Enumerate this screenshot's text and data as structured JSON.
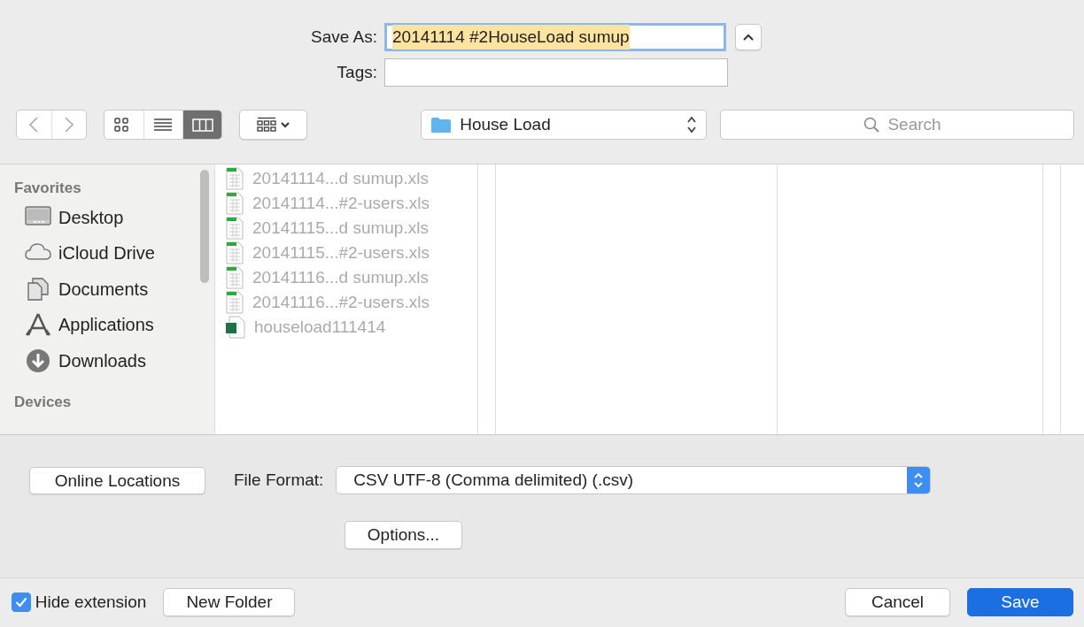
{
  "save_as": {
    "label": "Save As:",
    "value": "20141114 #2HouseLoad sumup"
  },
  "tags": {
    "label": "Tags:"
  },
  "view_modes": [
    {
      "kind": "icons",
      "selected": false
    },
    {
      "kind": "list",
      "selected": false
    },
    {
      "kind": "columns",
      "selected": true
    }
  ],
  "location": {
    "value": "House Load"
  },
  "search": {
    "placeholder": "Search"
  },
  "sidebar": {
    "sections": [
      {
        "title": "Favorites",
        "items": [
          {
            "kind": "desktop",
            "label": "Desktop"
          },
          {
            "kind": "cloud",
            "label": "iCloud Drive"
          },
          {
            "kind": "documents",
            "label": "Documents"
          },
          {
            "kind": "applications",
            "label": "Applications"
          },
          {
            "kind": "downloads",
            "label": "Downloads"
          }
        ]
      },
      {
        "title": "Devices"
      }
    ]
  },
  "files": [
    {
      "kind": "sheet",
      "name": "20141114...d sumup.xls",
      "disabled": true
    },
    {
      "kind": "sheet",
      "name": "20141114...#2-users.xls",
      "disabled": true
    },
    {
      "kind": "sheet",
      "name": "20141115...d sumup.xls",
      "disabled": true
    },
    {
      "kind": "sheet",
      "name": "20141115...#2-users.xls",
      "disabled": true
    },
    {
      "kind": "sheet",
      "name": "20141116...d sumup.xls",
      "disabled": true
    },
    {
      "kind": "sheet",
      "name": "20141116...#2-users.xls",
      "disabled": true
    },
    {
      "kind": "excel",
      "name": "houseload111414",
      "disabled": true
    }
  ],
  "online_locations": "Online Locations",
  "file_format": {
    "label": "File Format:",
    "value": "CSV UTF-8 (Comma delimited) (.csv)"
  },
  "options_button": "Options...",
  "hide_extension": {
    "label": "Hide extension",
    "checked": true
  },
  "new_folder": "New Folder",
  "buttons": [
    {
      "kind": "cancel",
      "label": "Cancel"
    },
    {
      "kind": "save",
      "label": "Save"
    }
  ]
}
